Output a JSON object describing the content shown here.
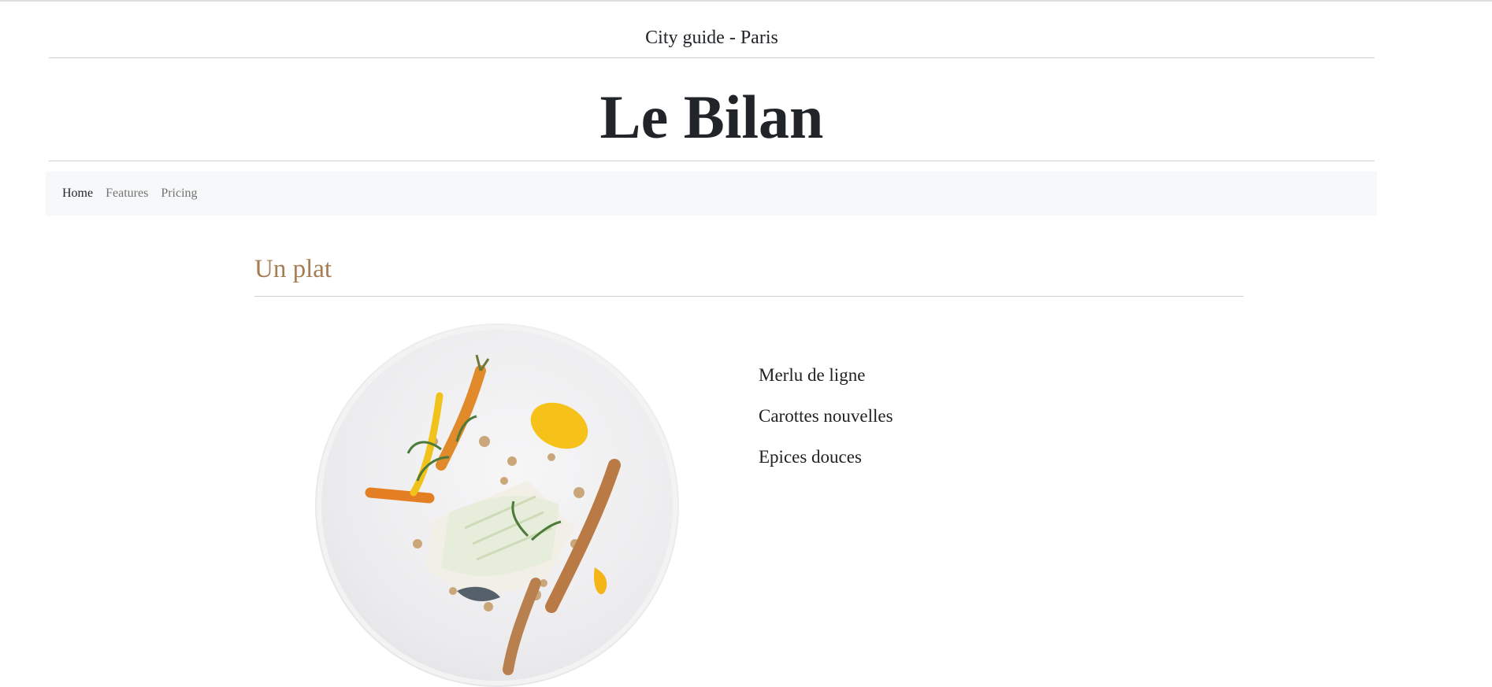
{
  "header": {
    "subtitle": "City guide - Paris",
    "title": "Le Bilan"
  },
  "nav": {
    "items": [
      {
        "label": "Home",
        "active": true
      },
      {
        "label": "Features",
        "active": false
      },
      {
        "label": "Pricing",
        "active": false
      }
    ]
  },
  "section": {
    "title": "Un plat",
    "ingredients": [
      "Merlu de ligne",
      "Carottes nouvelles",
      "Epices douces"
    ]
  },
  "colors": {
    "accent": "#a67c52",
    "text": "#212529",
    "nav_bg": "#f7f8f9"
  }
}
